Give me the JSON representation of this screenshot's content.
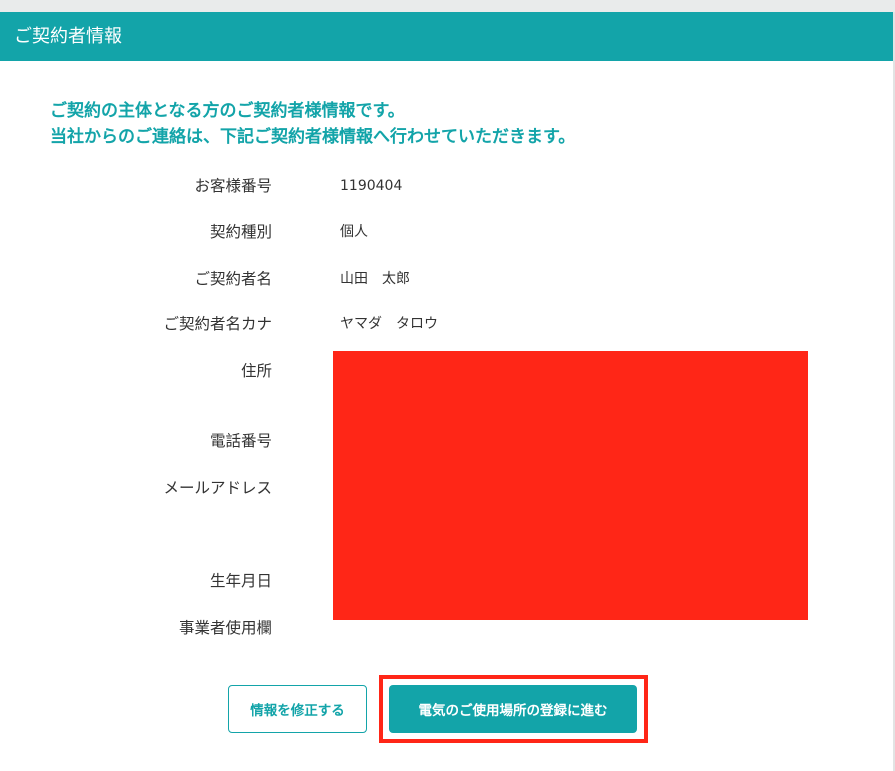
{
  "header": {
    "title": "ご契約者情報"
  },
  "intro": {
    "line1": "ご契約の主体となる方のご契約者様情報です。",
    "line2": "当社からのご連絡は、下記ご契約者様情報へ行わせていただきます。"
  },
  "fields": [
    {
      "label": "お客様番号",
      "value": "1190404"
    },
    {
      "label": "契約種別",
      "value": "個人"
    },
    {
      "label": "ご契約者名",
      "value": "山田　太郎"
    },
    {
      "label": "ご契約者名カナ",
      "value": "ヤマダ　タロウ"
    },
    {
      "label": "住所",
      "value": ""
    },
    {
      "label": "電話番号",
      "value": ""
    },
    {
      "label": "メールアドレス",
      "value": ""
    },
    {
      "label": "生年月日",
      "value": ""
    },
    {
      "label": "事業者使用欄",
      "value": ""
    }
  ],
  "buttons": {
    "edit_label": "情報を修正する",
    "next_label": "電気のご使用場所の登録に進む"
  },
  "colors": {
    "accent": "#13a4a9",
    "redaction": "#ff2617",
    "highlight": "#ff2617"
  }
}
